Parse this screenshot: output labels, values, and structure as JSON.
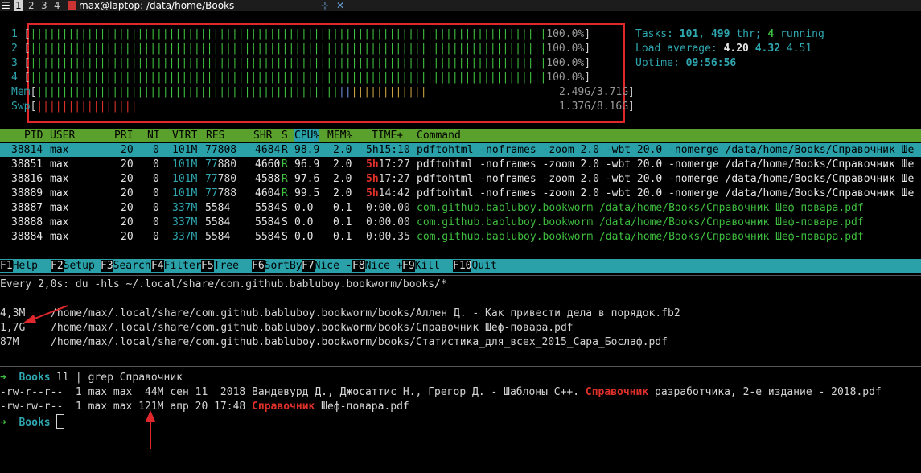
{
  "workspaces": [
    "1",
    "2",
    "3",
    "4"
  ],
  "window_title": "max@laptop: /data/home/Books",
  "htop": {
    "cpus": [
      {
        "id": "1",
        "value": "100.0%"
      },
      {
        "id": "2",
        "value": "100.0%"
      },
      {
        "id": "3",
        "value": "100.0%"
      },
      {
        "id": "4",
        "value": "100.0%"
      }
    ],
    "mem": {
      "label": "Mem",
      "value": "2.49G/3.71G",
      "fraction": 0.67
    },
    "swp": {
      "label": "Swp",
      "value": "1.37G/8.16G",
      "fraction": 0.17
    },
    "tasks_label": "Tasks:",
    "tasks": "101",
    "thr": "499",
    "thr_label": "thr;",
    "running": "4",
    "running_label": "running",
    "load_label": "Load average:",
    "load1": "4.20",
    "load5": "4.32",
    "load15": "4.51",
    "uptime_label": "Uptime:",
    "uptime": "09:56:56",
    "columns": [
      "PID",
      "USER",
      "PRI",
      "NI",
      "VIRT",
      "RES",
      "SHR",
      "S",
      "CPU%",
      "MEM%",
      "TIME+",
      "Command"
    ],
    "processes": [
      {
        "pid": "38814",
        "user": "max",
        "pri": "20",
        "ni": "0",
        "virt": "101M",
        "res": "77808",
        "shr": "4684",
        "s": "R",
        "cpu": "98.9",
        "mem": "2.0",
        "time": "5h15:10",
        "cmd": "pdftohtml -noframes -zoom 2.0 -wbt 20.0 -nomerge /data/home/Books/Справочник Ше"
      },
      {
        "pid": "38851",
        "user": "max",
        "pri": "20",
        "ni": "0",
        "virt": "101M",
        "res": "77880",
        "shr": "4660",
        "s": "R",
        "cpu": "96.9",
        "mem": "2.0",
        "time": "5h17:27",
        "cmd": "pdftohtml -noframes -zoom 2.0 -wbt 20.0 -nomerge /data/home/Books/Справочник Ше"
      },
      {
        "pid": "38816",
        "user": "max",
        "pri": "20",
        "ni": "0",
        "virt": "101M",
        "res": "77780",
        "shr": "4588",
        "s": "R",
        "cpu": "97.6",
        "mem": "2.0",
        "time": "5h17:27",
        "cmd": "pdftohtml -noframes -zoom 2.0 -wbt 20.0 -nomerge /data/home/Books/Справочник Ше"
      },
      {
        "pid": "38889",
        "user": "max",
        "pri": "20",
        "ni": "0",
        "virt": "101M",
        "res": "77788",
        "shr": "4604",
        "s": "R",
        "cpu": "99.5",
        "mem": "2.0",
        "time": "5h14:42",
        "cmd": "pdftohtml -noframes -zoom 2.0 -wbt 20.0 -nomerge /data/home/Books/Справочник Ше"
      },
      {
        "pid": "38887",
        "user": "max",
        "pri": "20",
        "ni": "0",
        "virt": "337M",
        "res": "5584",
        "shr": "5584",
        "s": "S",
        "cpu": "0.0",
        "mem": "0.1",
        "time": "0:00.00",
        "cmd": "com.github.babluboy.bookworm /data/home/Books/Справочник Шеф-повара.pdf"
      },
      {
        "pid": "38888",
        "user": "max",
        "pri": "20",
        "ni": "0",
        "virt": "337M",
        "res": "5584",
        "shr": "5584",
        "s": "S",
        "cpu": "0.0",
        "mem": "0.1",
        "time": "0:00.00",
        "cmd": "com.github.babluboy.bookworm /data/home/Books/Справочник Шеф-повара.pdf"
      },
      {
        "pid": "38884",
        "user": "max",
        "pri": "20",
        "ni": "0",
        "virt": "337M",
        "res": "5584",
        "shr": "5584",
        "s": "S",
        "cpu": "0.0",
        "mem": "0.1",
        "time": "0:00.35",
        "cmd": "com.github.babluboy.bookworm /data/home/Books/Справочник Шеф-повара.pdf"
      }
    ],
    "fkeys": [
      {
        "n": "F1",
        "t": "Help  "
      },
      {
        "n": "F2",
        "t": "Setup "
      },
      {
        "n": "F3",
        "t": "Search"
      },
      {
        "n": "F4",
        "t": "Filter"
      },
      {
        "n": "F5",
        "t": "Tree  "
      },
      {
        "n": "F6",
        "t": "SortBy"
      },
      {
        "n": "F7",
        "t": "Nice -"
      },
      {
        "n": "F8",
        "t": "Nice +"
      },
      {
        "n": "F9",
        "t": "Kill  "
      },
      {
        "n": "F10",
        "t": "Quit"
      }
    ]
  },
  "watch": {
    "header": "Every 2,0s: du -hls ~/.local/share/com.github.babluboy.bookworm/books/*",
    "lines": [
      {
        "size": "4,3M",
        "path": "/home/max/.local/share/com.github.babluboy.bookworm/books/Аллен Д. - Как привести дела в порядок.fb2"
      },
      {
        "size": "1,7G",
        "path": "/home/max/.local/share/com.github.babluboy.bookworm/books/Справочник Шеф-повара.pdf"
      },
      {
        "size": "87M",
        "path": "/home/max/.local/share/com.github.babluboy.bookworm/books/Статистика_для_всех_2015_Сара_Бослаф.pdf"
      }
    ]
  },
  "shell": {
    "prompt_arrow": "➜",
    "dir": "Books",
    "command": "ll | grep Справочник",
    "ls": [
      {
        "pre": "-rw-r--r--  1 max max  44M сен 11  2018 Вандевурд Д., Джосаттис Н., Грегор Д. - Шаблоны С++. ",
        "match": "Справочник",
        "post": " разработчика, 2-е издание - 2018.pdf"
      },
      {
        "pre": "-rw-rw-r--  1 max max 121M апр 20 17:48 ",
        "match": "Справочник",
        "post": " Шеф-повара.pdf"
      }
    ]
  }
}
